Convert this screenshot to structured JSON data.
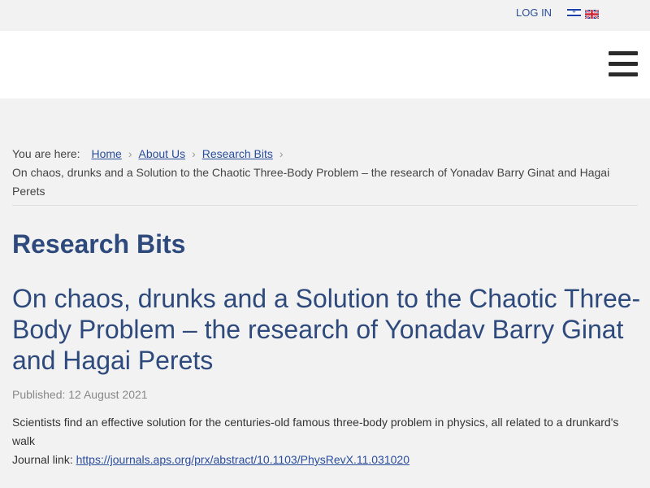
{
  "topbar": {
    "login_label": "LOG IN",
    "languages": [
      {
        "code": "he",
        "icon": "israel-flag-icon"
      },
      {
        "code": "en",
        "icon": "uk-flag-icon"
      }
    ]
  },
  "header": {
    "menu_icon": "hamburger-menu-icon"
  },
  "breadcrumb": {
    "prefix": "You are here:",
    "items": [
      {
        "label": "Home"
      },
      {
        "label": "About Us"
      },
      {
        "label": "Research Bits"
      }
    ],
    "separator": "›",
    "current": "On chaos, drunks and a Solution to the Chaotic Three-Body Problem – the research of Yonadav Barry Ginat and Hagai Perets"
  },
  "section": {
    "title": "Research Bits"
  },
  "article": {
    "title": "On chaos, drunks and a Solution to the Chaotic Three-Body Problem – the research of Yonadav Barry Ginat and Hagai Perets",
    "published": "Published: 12 August 2021",
    "summary": "Scientists find an effective solution for the centuries-old famous three-body problem in physics, all related to a drunkard's walk",
    "journal_prefix": "Journal link:",
    "journal_link": "https://journals.aps.org/prx/abstract/10.1103/PhysRevX.11.031020"
  },
  "colors": {
    "link": "#2a4d9c",
    "heading": "#2e4a7d",
    "background": "#f2f2f2",
    "header_bg": "#ffffff"
  }
}
